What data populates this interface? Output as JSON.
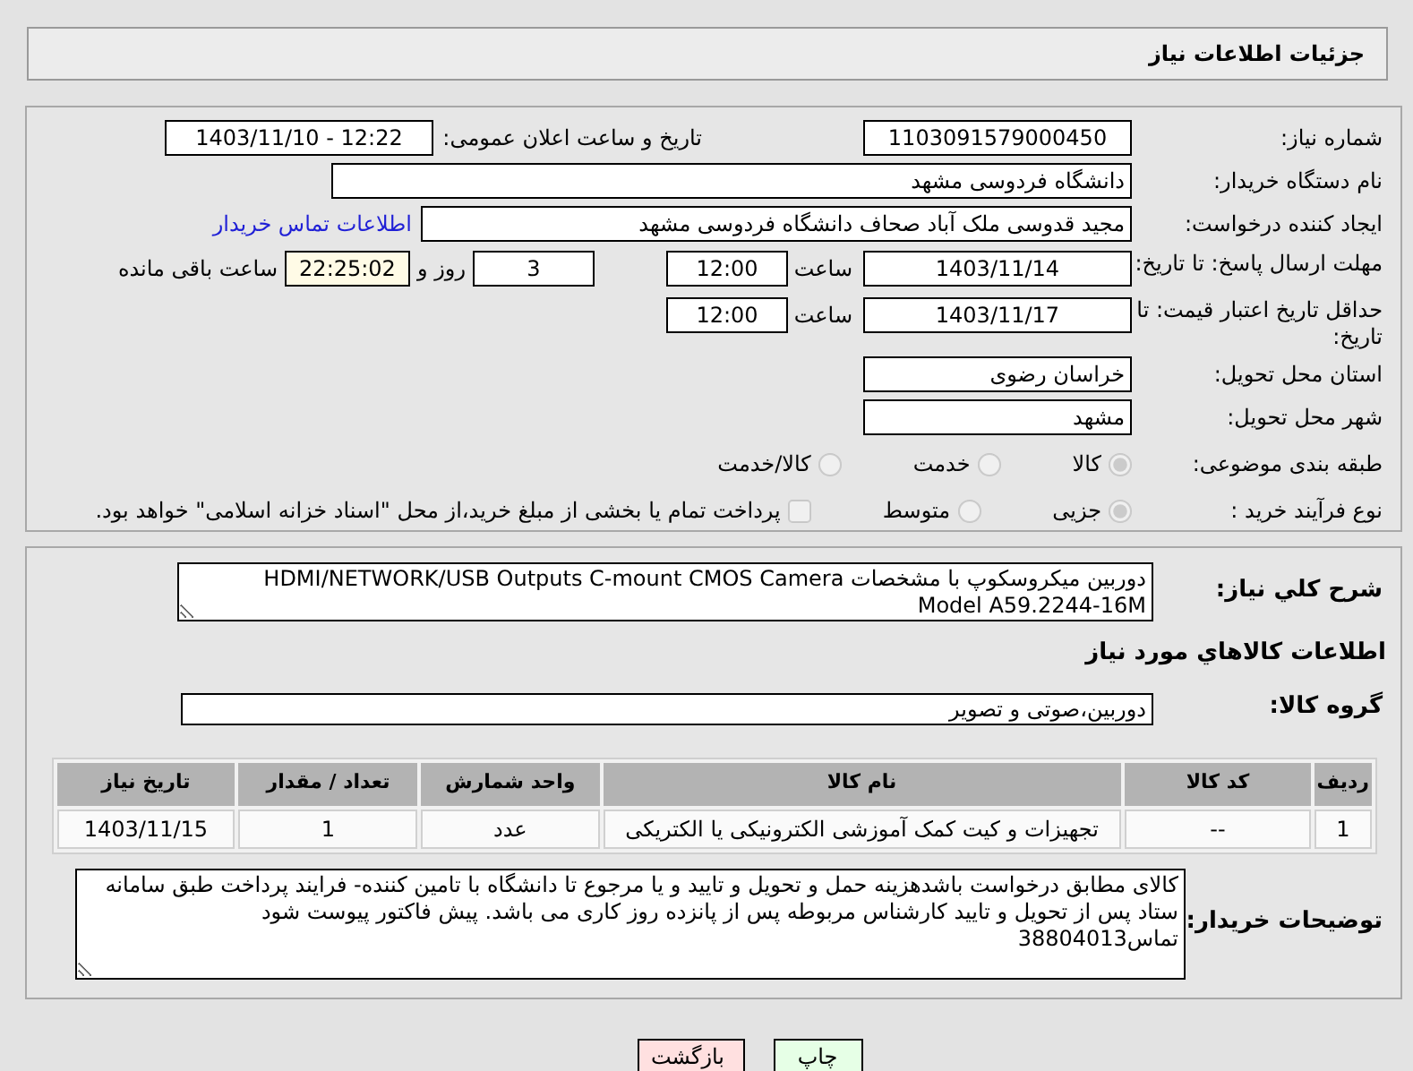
{
  "page_title": "جزئیات اطلاعات نیاز",
  "need_number": {
    "label": "شماره نیاز:",
    "value": "1103091579000450"
  },
  "announce": {
    "label": "تاریخ و ساعت اعلان عمومی:",
    "value": "1403/11/10 - 12:22"
  },
  "buyer_org": {
    "label": "نام دستگاه خریدار:",
    "value": "دانشگاه فردوسی مشهد"
  },
  "requester": {
    "label": "ایجاد کننده درخواست:",
    "value": "مجید قدوسی ملک آباد صحاف دانشگاه فردوسی مشهد",
    "contact_link": "اطلاعات تماس خریدار"
  },
  "deadline": {
    "label": "مهلت ارسال پاسخ: تا تاریخ:",
    "date": "1403/11/14",
    "time_label": "ساعت",
    "time": "12:00",
    "days": "3",
    "days_label": "روز و",
    "remaining": "22:25:02",
    "remaining_label": "ساعت باقی مانده"
  },
  "price_validity": {
    "label": "حداقل تاریخ اعتبار قیمت: تا تاریخ:",
    "date": "1403/11/17",
    "time_label": "ساعت",
    "time": "12:00"
  },
  "province": {
    "label": "استان محل تحویل:",
    "value": "خراسان رضوی"
  },
  "city": {
    "label": "شهر محل تحویل:",
    "value": "مشهد"
  },
  "category": {
    "label": "طبقه بندی موضوعی:",
    "options": [
      {
        "label": "کالا",
        "selected": true
      },
      {
        "label": "خدمت",
        "selected": false
      },
      {
        "label": "کالا/خدمت",
        "selected": false
      }
    ]
  },
  "purchase_type": {
    "label": "نوع فرآیند خرید :",
    "options": [
      {
        "label": "جزیی",
        "selected": true
      },
      {
        "label": "متوسط",
        "selected": false
      }
    ],
    "payment_note": {
      "label": "پرداخت تمام یا بخشی از مبلغ خرید،از محل \"اسناد خزانه اسلامی\" خواهد بود.",
      "checked": false
    }
  },
  "description": {
    "label": "شرح کلي نياز:",
    "value": "دوربین میکروسکوپ با مشخصات HDMI/NETWORK/USB Outputs C-mount CMOS Camera\nModel A59.2244-16M"
  },
  "goods_heading": "اطلاعات کالاهاي مورد نياز",
  "goods_group": {
    "label": "گروه کالا:",
    "value": "دوربین،صوتی و تصویر"
  },
  "table": {
    "columns": [
      "ردیف",
      "کد کالا",
      "نام کالا",
      "واحد شمارش",
      "تعداد / مقدار",
      "تاریخ نیاز"
    ],
    "rows": [
      [
        "1",
        "--",
        "تجهیزات و کیت کمک آموزشی الکترونیکی یا الکتریکی",
        "عدد",
        "1",
        "1403/11/15"
      ]
    ]
  },
  "buyer_notes": {
    "label": "توضیحات خریدار:",
    "value": "کالای مطابق درخواست باشدهزینه حمل و تحویل و تایید و یا مرجوع تا دانشگاه با تامین کننده- فرایند پرداخت طبق سامانه ستاد پس از تحویل و تایید کارشناس مربوطه پس از پانزده روز کاری می باشد. پیش فاکتور پیوست شود\nتماس38804013"
  },
  "buttons": [
    {
      "label": "چاپ",
      "kind": "print"
    },
    {
      "label": "بازگشت",
      "kind": "back"
    }
  ]
}
